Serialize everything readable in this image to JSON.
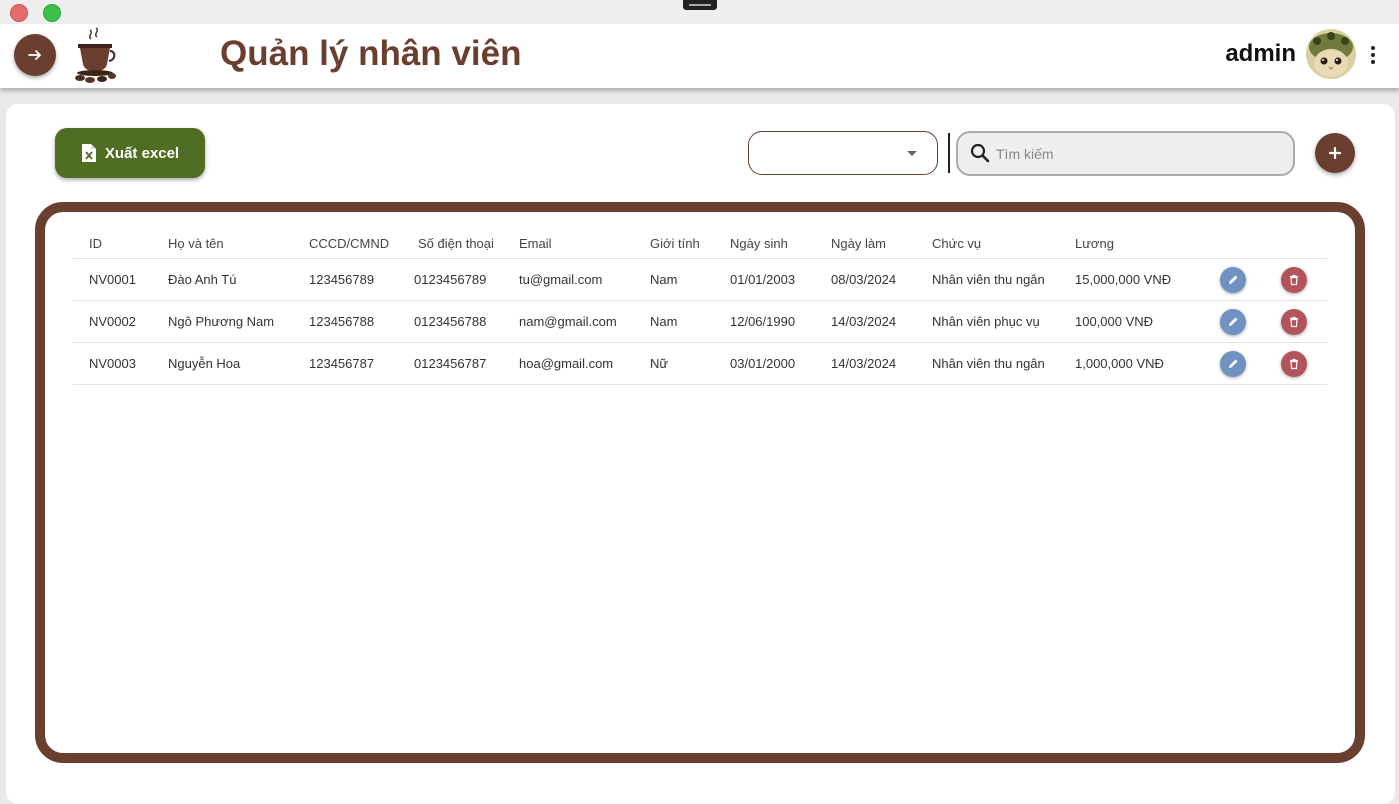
{
  "window": {
    "controls": [
      "close",
      "maximize"
    ]
  },
  "header": {
    "title": "Quản lý nhân viên",
    "user_name": "admin",
    "icons": {
      "nav": "arrow-right-icon",
      "more": "more-vert-icon",
      "logo": "coffee-logo"
    }
  },
  "toolbar": {
    "export_label": "Xuất excel",
    "filter_value": "",
    "search_placeholder": "Tìm kiếm",
    "search_value": ""
  },
  "table": {
    "headers": [
      "ID",
      "Họ và tên",
      "CCCD/CMND",
      "Số điện thoại",
      "Email",
      "Giới tính",
      "Ngày sinh",
      "Ngày làm",
      "Chức vụ",
      "Lương"
    ],
    "rows": [
      [
        "NV0001",
        "Đào Anh Tú",
        "123456789",
        "0123456789",
        "tu@gmail.com",
        "Nam",
        "01/01/2003",
        "08/03/2024",
        "Nhân viên thu ngân",
        "15,000,000 VNĐ"
      ],
      [
        "NV0002",
        "Ngô Phương Nam",
        "123456788",
        "0123456788",
        "nam@gmail.com",
        "Nam",
        "12/06/1990",
        "14/03/2024",
        "Nhân viên phục vụ",
        "100,000 VNĐ"
      ],
      [
        "NV0003",
        "Nguyễn Hoa",
        "123456787",
        "0123456787",
        "hoa@gmail.com",
        "Nữ",
        "03/01/2000",
        "14/03/2024",
        "Nhân viên thu ngân",
        "1,000,000 VNĐ"
      ]
    ]
  },
  "colors": {
    "brand": "#6b3f2f",
    "export": "#4f6d23",
    "edit": "#6f92c2",
    "delete": "#b3545c"
  }
}
